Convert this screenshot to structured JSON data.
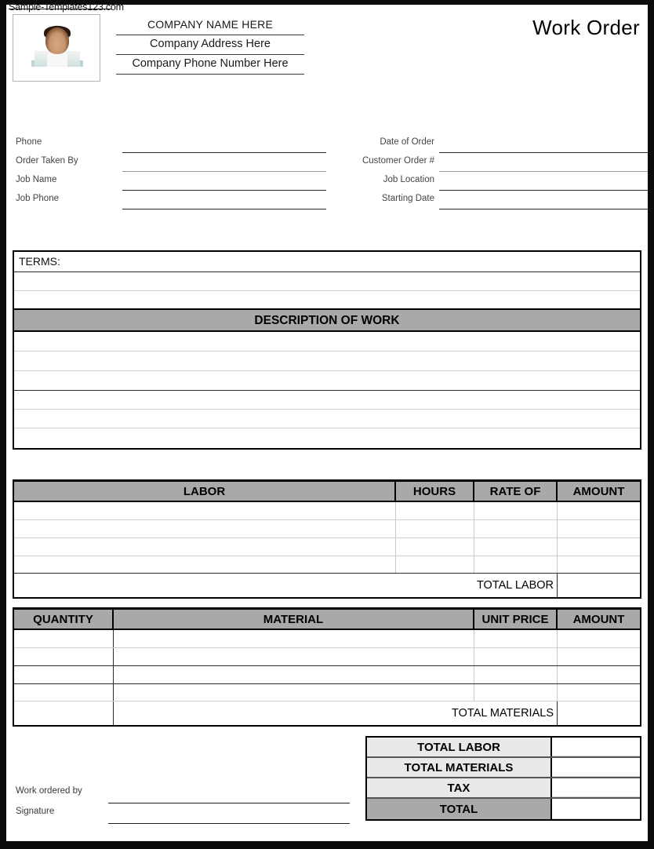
{
  "watermark": "Sample-Templates123.com",
  "header": {
    "title": "Work Order",
    "company_name": "COMPANY NAME HERE",
    "company_address": "Company Address Here",
    "company_phone": "Company Phone Number Here",
    "photo_alt": "company-photo-placeholder"
  },
  "fields": {
    "left": [
      {
        "label": "Phone",
        "value": ""
      },
      {
        "label": "Order Taken By",
        "value": ""
      },
      {
        "label": "Job Name",
        "value": ""
      },
      {
        "label": "Job Phone",
        "value": ""
      }
    ],
    "right": [
      {
        "label": "Date of Order",
        "value": ""
      },
      {
        "label": "Customer Order #",
        "value": ""
      },
      {
        "label": "Job Location",
        "value": ""
      },
      {
        "label": "Starting Date",
        "value": ""
      }
    ]
  },
  "terms": {
    "label": "TERMS:",
    "rows": [
      "",
      "",
      ""
    ]
  },
  "description": {
    "band_label": "DESCRIPTION OF WORK",
    "rows": [
      "",
      "",
      "",
      "",
      "",
      ""
    ]
  },
  "labor_table": {
    "columns": [
      "LABOR",
      "HOURS",
      "RATE OF",
      "AMOUNT"
    ],
    "rows": [
      [
        "",
        "",
        "",
        ""
      ],
      [
        "",
        "",
        "",
        ""
      ],
      [
        "",
        "",
        "",
        ""
      ],
      [
        "",
        "",
        "",
        ""
      ]
    ],
    "total_label": "TOTAL LABOR",
    "total_value": ""
  },
  "material_table": {
    "columns": [
      "QUANTITY",
      "MATERIAL",
      "UNIT PRICE",
      "AMOUNT"
    ],
    "rows": [
      [
        "",
        "",
        "",
        ""
      ],
      [
        "",
        "",
        "",
        ""
      ],
      [
        "",
        "",
        "",
        ""
      ],
      [
        "",
        "",
        "",
        ""
      ]
    ],
    "total_label": "TOTAL MATERIALS",
    "total_value": ""
  },
  "totals_box": {
    "rows": [
      {
        "label": "TOTAL LABOR",
        "value": ""
      },
      {
        "label": "TOTAL MATERIALS",
        "value": ""
      },
      {
        "label": "TAX",
        "value": ""
      },
      {
        "label": "TOTAL",
        "value": ""
      }
    ]
  },
  "signature": {
    "ordered_by_label": "Work ordered by",
    "ordered_by_value": "",
    "signature_label": "Signature",
    "signature_value": ""
  },
  "colors": {
    "band_gray": "#a9a9a9",
    "totals_light_gray": "#e9e9e9",
    "frame_black": "#0b0b0b"
  }
}
